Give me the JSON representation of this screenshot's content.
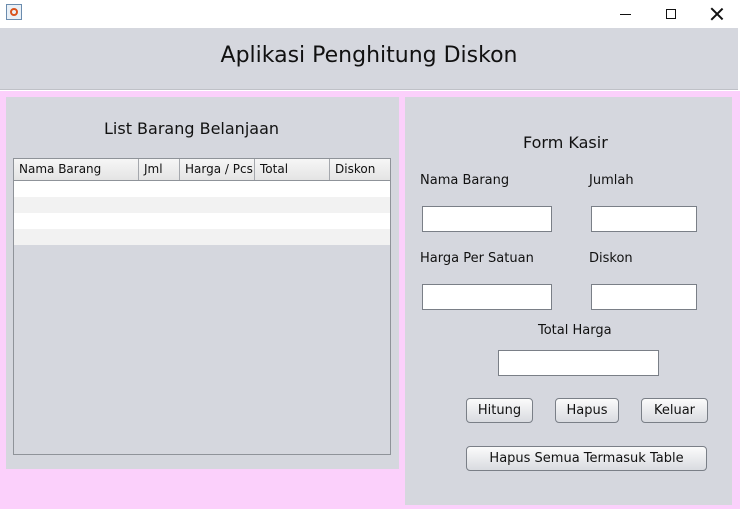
{
  "window": {
    "icon": "java-app-icon",
    "controls": [
      "minimize-icon",
      "maximize-icon",
      "close-icon"
    ]
  },
  "header": {
    "title": "Aplikasi Penghitung Diskon"
  },
  "list_panel": {
    "title": "List Barang Belanjaan",
    "table": {
      "columns": [
        "Nama Barang",
        "Jml",
        "Harga / Pcs",
        "Total",
        "Diskon"
      ],
      "rows": [
        [
          "",
          "",
          "",
          "",
          ""
        ],
        [
          "",
          "",
          "",
          "",
          ""
        ],
        [
          "",
          "",
          "",
          "",
          ""
        ],
        [
          "",
          "",
          "",
          "",
          ""
        ]
      ]
    }
  },
  "form": {
    "title": "Form Kasir",
    "nama_barang": {
      "label": "Nama Barang",
      "value": ""
    },
    "jumlah": {
      "label": "Jumlah",
      "value": ""
    },
    "harga_per_satuan": {
      "label": "Harga Per Satuan",
      "value": ""
    },
    "diskon": {
      "label": "Diskon",
      "value": ""
    },
    "total_harga": {
      "label": "Total Harga",
      "value": ""
    },
    "buttons": {
      "hitung": "Hitung",
      "hapus": "Hapus",
      "keluar": "Keluar",
      "hapus_semua": "Hapus Semua Termasuk Table"
    }
  },
  "colors": {
    "panel": "#d5d7de",
    "background": "#fbd0fb",
    "input": "#ffffff"
  }
}
